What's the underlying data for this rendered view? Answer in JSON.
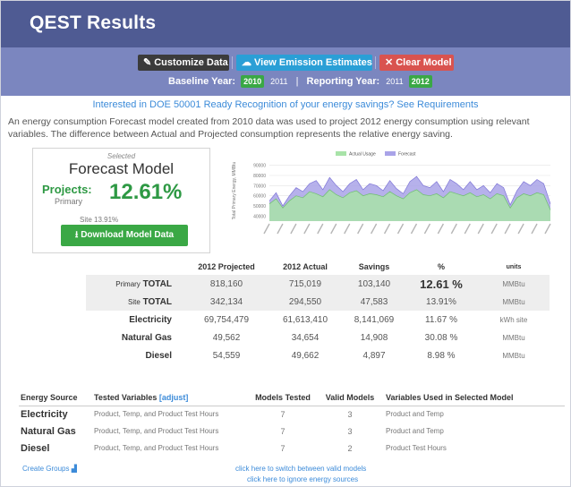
{
  "header": {
    "title": "QEST Results"
  },
  "toolbar": {
    "customize_label": "Customize Data",
    "emission_label": "View Emission Estimates",
    "clear_label": "Clear Model",
    "baseline_label": "Baseline Year:",
    "baseline_selected": "2010",
    "baseline_other": "2011",
    "reporting_label": "Reporting Year:",
    "reporting_other": "2011",
    "reporting_selected": "2012",
    "colors": {
      "header": "#4f5b93",
      "toolbar": "#7b86bf",
      "green": "#3aa845",
      "blue": "#2a9fd6",
      "red": "#d9534f"
    }
  },
  "doe_link": "Interested in DOE 50001 Ready Recognition of your energy savings? See Requirements",
  "intro": "An energy consumption Forecast model created from 2010 data was used to project 2012 energy consumption using relevant variables. The difference between Actual and Projected consumption represents the relative energy saving.",
  "model": {
    "selected": "Selected",
    "title": "Forecast Model",
    "projects_label": "Projects:",
    "primary_label": "Primary",
    "primary_value": "12.61%",
    "site_label": "Site",
    "site_value": "13.91%",
    "download_label": "Download Model Data"
  },
  "chart_data": {
    "type": "area",
    "ylabel": "Total Primary Energy, MMBtu",
    "ylim": [
      35000,
      95000
    ],
    "yticks": [
      "90000",
      "80000",
      "70000",
      "60000",
      "50000",
      "40000"
    ],
    "series": [
      {
        "name": "Actual Usage",
        "color": "#a8e3a8",
        "values": [
          52000,
          57000,
          48000,
          55000,
          60000,
          58000,
          64000,
          62000,
          59000,
          66000,
          61000,
          58000,
          63000,
          65000,
          60000,
          62000,
          61000,
          59000,
          64000,
          60000,
          57000,
          63000,
          66000,
          61000,
          60000,
          62000,
          58000,
          64000,
          62000,
          60000,
          63000,
          59000,
          61000,
          57000,
          62000,
          60000,
          48000,
          58000,
          62000,
          60000,
          63000,
          61000,
          46000
        ]
      },
      {
        "name": "Forecast",
        "color": "#a9a3e8",
        "values": [
          55000,
          63000,
          50000,
          60000,
          68000,
          64000,
          72000,
          75000,
          66000,
          78000,
          70000,
          64000,
          72000,
          76000,
          66000,
          72000,
          70000,
          65000,
          75000,
          67000,
          62000,
          74000,
          79000,
          70000,
          68000,
          74000,
          64000,
          76000,
          72000,
          66000,
          74000,
          66000,
          70000,
          63000,
          72000,
          68000,
          51000,
          65000,
          74000,
          70000,
          76000,
          72000,
          52000
        ]
      }
    ]
  },
  "results": {
    "headers": [
      "",
      "2012 Projected",
      "2012 Actual",
      "Savings",
      "%",
      "units"
    ],
    "rows": [
      {
        "prefix": "Primary",
        "label": "TOTAL",
        "projected": "818,160",
        "actual": "715,019",
        "savings": "103,140",
        "pct": "12.61 %",
        "unit": "MMBtu"
      },
      {
        "prefix": "Site",
        "label": "TOTAL",
        "projected": "342,134",
        "actual": "294,550",
        "savings": "47,583",
        "pct": "13.91%",
        "unit": "MMBtu"
      },
      {
        "prefix": "",
        "label": "Electricity",
        "projected": "69,754,479",
        "actual": "61,613,410",
        "savings": "8,141,069",
        "pct": "11.67 %",
        "unit": "kWh site"
      },
      {
        "prefix": "",
        "label": "Natural Gas",
        "projected": "49,562",
        "actual": "34,654",
        "savings": "14,908",
        "pct": "30.08 %",
        "unit": "MMBtu"
      },
      {
        "prefix": "",
        "label": "Diesel",
        "projected": "54,559",
        "actual": "49,662",
        "savings": "4,897",
        "pct": "8.98 %",
        "unit": "MMBtu"
      }
    ]
  },
  "variables": {
    "headers": {
      "source": "Energy Source",
      "tested": "Tested Variables",
      "adjust": "[adjust]",
      "models": "Models Tested",
      "valid": "Valid Models",
      "used": "Variables Used in Selected Model"
    },
    "rows": [
      {
        "source": "Electricity",
        "tested": "Product, Temp, and Product Test Hours",
        "models": "7",
        "valid": "3",
        "used": "Product and Temp"
      },
      {
        "source": "Natural Gas",
        "tested": "Product, Temp, and Product Test Hours",
        "models": "7",
        "valid": "3",
        "used": "Product and Temp"
      },
      {
        "source": "Diesel",
        "tested": "Product, Temp, and Product Test Hours",
        "models": "7",
        "valid": "2",
        "used": "Product Test Hours"
      }
    ]
  },
  "footer": {
    "create_groups": "Create Groups",
    "switch_models": "click here to switch between valid models",
    "ignore_sources": "click here to ignore energy sources"
  }
}
